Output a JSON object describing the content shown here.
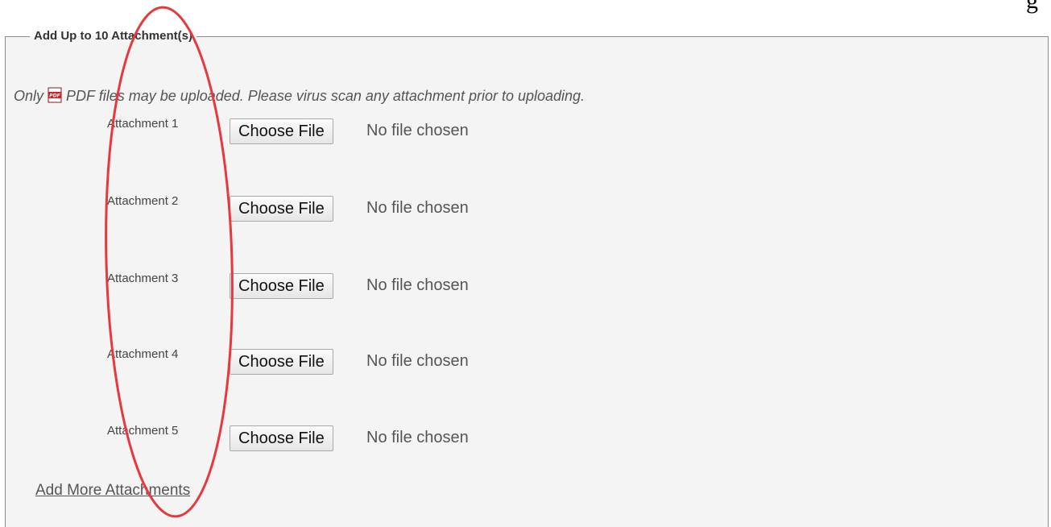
{
  "corner_glyph": "g",
  "fieldset": {
    "legend": "Add Up to 10 Attachment(s)"
  },
  "notice": {
    "prefix": "Only",
    "icon": "pdf-icon",
    "text": "PDF files may be uploaded. Please virus scan any attachment prior to uploading."
  },
  "attachments": [
    {
      "label": "Attachment 1",
      "button": "Choose File",
      "status": "No file chosen"
    },
    {
      "label": "Attachment 2",
      "button": "Choose File",
      "status": "No file chosen"
    },
    {
      "label": "Attachment 3",
      "button": "Choose File",
      "status": "No file chosen"
    },
    {
      "label": "Attachment 4",
      "button": "Choose File",
      "status": "No file chosen"
    },
    {
      "label": "Attachment 5",
      "button": "Choose File",
      "status": "No file chosen"
    }
  ],
  "add_more_link": "Add More Attachments",
  "colors": {
    "panel_background": "#f4f4f4",
    "annotation": "#e8383d",
    "pdf_icon": "#d42020"
  }
}
